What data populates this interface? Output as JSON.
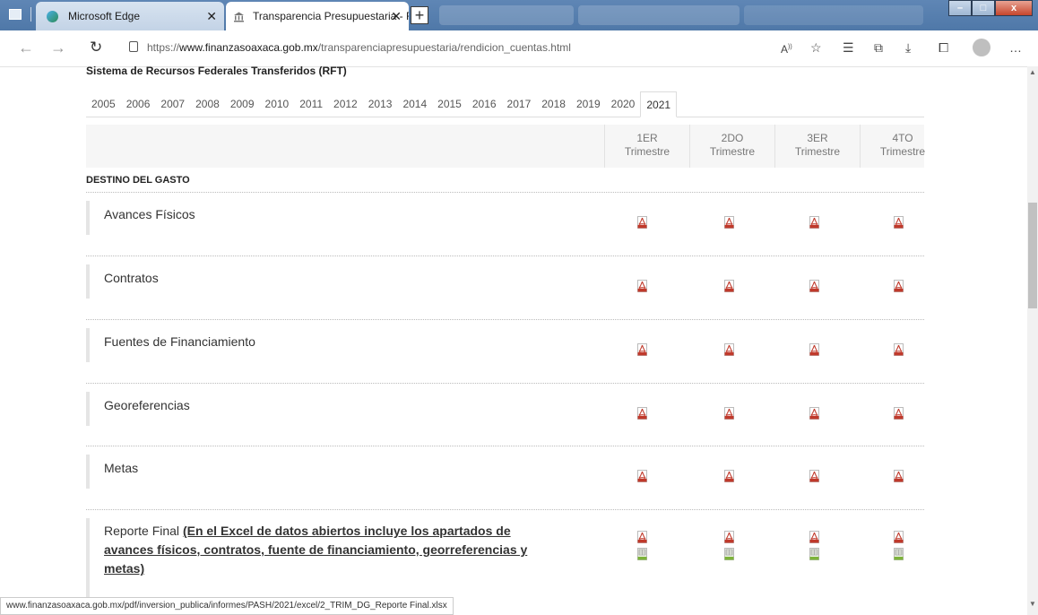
{
  "browser": {
    "tabs": [
      {
        "title": "Microsoft Edge"
      },
      {
        "title": "Transparencia Presupuestaria - Rc"
      }
    ],
    "new_tab_label": "+",
    "close_glyph": "✕",
    "url_prefix": "https://",
    "url_domain": "www.finanzasoaxaca.gob.mx",
    "url_path": "/transparenciapresupuestaria/rendicion_cuentas.html",
    "window_buttons": [
      "–",
      "□",
      "x"
    ]
  },
  "page": {
    "section_heading": "Sistema de Recursos Federales Transferidos (RFT)",
    "years": [
      "2005",
      "2006",
      "2007",
      "2008",
      "2009",
      "2010",
      "2011",
      "2012",
      "2013",
      "2014",
      "2015",
      "2016",
      "2017",
      "2018",
      "2019",
      "2020",
      "2021"
    ],
    "active_year": "2021",
    "quarters": [
      {
        "num": "1ER",
        "label": "Trimestre"
      },
      {
        "num": "2DO",
        "label": "Trimestre"
      },
      {
        "num": "3ER",
        "label": "Trimestre"
      },
      {
        "num": "4TO",
        "label": "Trimestre"
      }
    ],
    "group_title": "DESTINO DEL GASTO",
    "rows": [
      {
        "label": "Avances Físicos",
        "files": [
          "pdf"
        ]
      },
      {
        "label": "Contratos",
        "files": [
          "pdf"
        ]
      },
      {
        "label": "Fuentes de Financiamiento",
        "files": [
          "pdf"
        ]
      },
      {
        "label": "Georeferencias",
        "files": [
          "pdf"
        ]
      },
      {
        "label": "Metas",
        "files": [
          "pdf"
        ]
      },
      {
        "label": "Reporte Final",
        "link_lines": [
          "(En el Excel de datos abiertos incluye los apartados de",
          "avances físicos, contratos, fuente de financiamiento, georreferencias y",
          "metas)"
        ],
        "files": [
          "pdf",
          "xlsx"
        ]
      }
    ]
  },
  "status_bar": {
    "text": "www.finanzasoaxaca.gob.mx/pdf/inversion_publica/informes/PASH/2021/excel/2_TRIM_DG_Reporte Final.xlsx"
  },
  "colors": {
    "titlebar": "#5b84b3",
    "pdf_red": "#c0392b",
    "xls_green": "#7db33a"
  }
}
